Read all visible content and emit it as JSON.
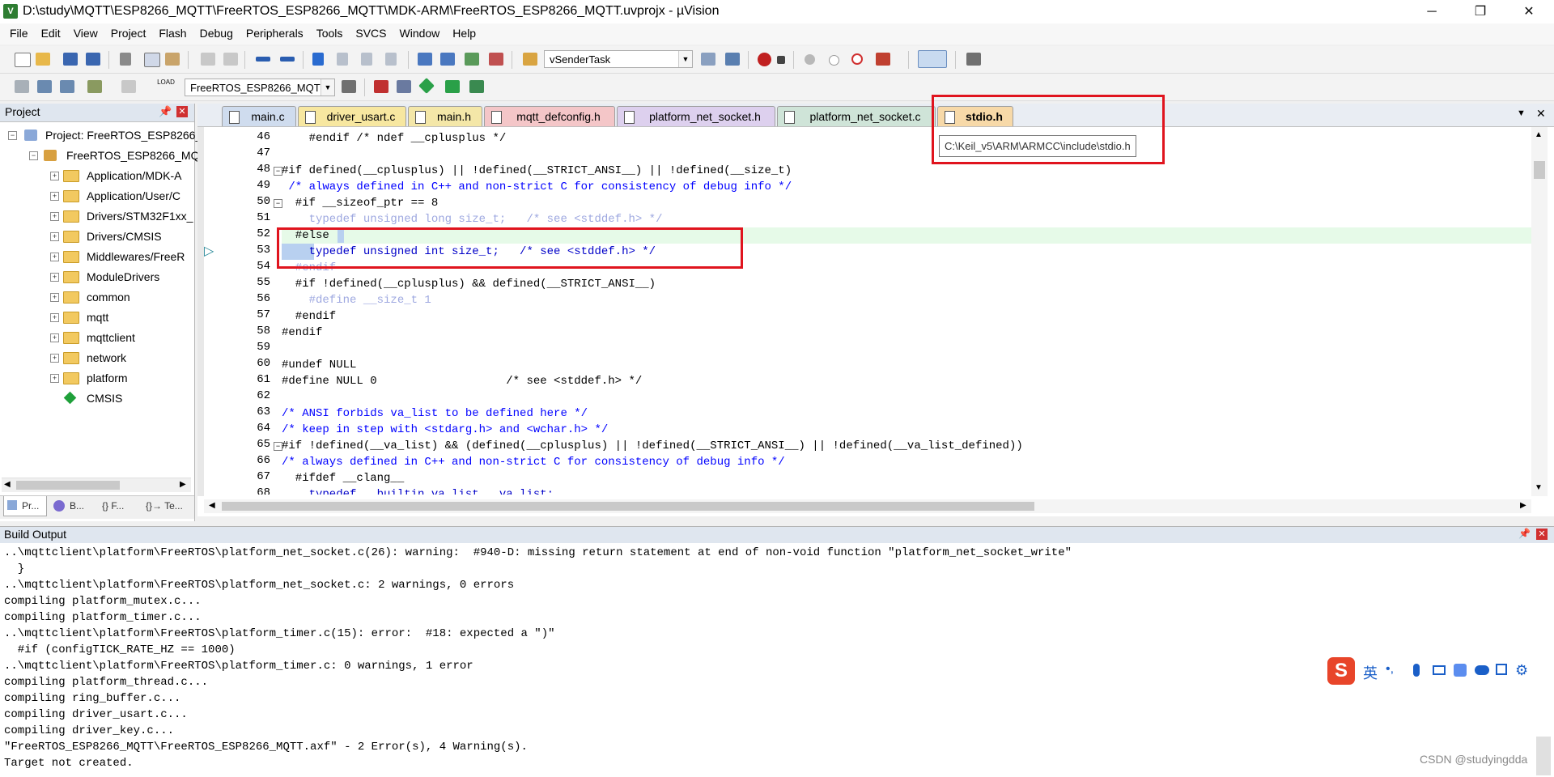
{
  "window": {
    "title": "D:\\study\\MQTT\\ESP8266_MQTT\\FreeRTOS_ESP8266_MQTT\\MDK-ARM\\FreeRTOS_ESP8266_MQTT.uvprojx - µVision",
    "minimize": "─",
    "maximize": "❐",
    "close": "✕"
  },
  "menu": [
    "File",
    "Edit",
    "View",
    "Project",
    "Flash",
    "Debug",
    "Peripherals",
    "Tools",
    "SVCS",
    "Window",
    "Help"
  ],
  "toolbar": {
    "task_combo": "vSenderTask",
    "target_combo": "FreeRTOS_ESP8266_MQT",
    "load_label": "LOAD"
  },
  "project_panel": {
    "title": "Project",
    "tree": [
      {
        "label": "Project: FreeRTOS_ESP8266_",
        "icon": "project-icon"
      },
      {
        "label": "FreeRTOS_ESP8266_MQT",
        "icon": "target-icon"
      },
      {
        "label": "Application/MDK-A",
        "icon": "folder-icon"
      },
      {
        "label": "Application/User/C",
        "icon": "folder-icon"
      },
      {
        "label": "Drivers/STM32F1xx_",
        "icon": "folder-icon"
      },
      {
        "label": "Drivers/CMSIS",
        "icon": "folder-icon"
      },
      {
        "label": "Middlewares/FreeR",
        "icon": "folder-icon"
      },
      {
        "label": "ModuleDrivers",
        "icon": "folder-icon"
      },
      {
        "label": "common",
        "icon": "folder-icon"
      },
      {
        "label": "mqtt",
        "icon": "folder-icon"
      },
      {
        "label": "mqttclient",
        "icon": "folder-icon"
      },
      {
        "label": "network",
        "icon": "folder-icon"
      },
      {
        "label": "platform",
        "icon": "folder-icon"
      },
      {
        "label": "CMSIS",
        "icon": "cmsis-diamond-icon"
      }
    ],
    "bottom_tabs": [
      "Pr...",
      "B...",
      "{} F...",
      "{}→ Te..."
    ]
  },
  "editor": {
    "tabs": [
      {
        "label": "main.c",
        "color": "#cfdcee"
      },
      {
        "label": "driver_usart.c",
        "color": "#f7e7a0"
      },
      {
        "label": "main.h",
        "color": "#f4e7a8"
      },
      {
        "label": "mqtt_defconfig.h",
        "color": "#f4c6c8"
      },
      {
        "label": "platform_net_socket.h",
        "color": "#ddd0ee"
      },
      {
        "label": "platform_net_socket.c",
        "color": "#cfe4d8"
      },
      {
        "label": "stdio.h",
        "color": "#f7d9a8"
      }
    ],
    "active_tab": "stdio.h",
    "tooltip": "C:\\Keil_v5\\ARM\\ARMCC\\include\\stdio.h",
    "lines": [
      {
        "n": "46",
        "text": "    #endif /* ndef __cplusplus */"
      },
      {
        "n": "47",
        "text": ""
      },
      {
        "n": "48",
        "text": "#if defined(__cplusplus) || !defined(__STRICT_ANSI__) || !defined(__size_t)"
      },
      {
        "n": "49",
        "text": " /* always defined in C++ and non-strict C for consistency of debug info */"
      },
      {
        "n": "50",
        "text": "  #if __sizeof_ptr == 8"
      },
      {
        "n": "51",
        "text": "    typedef unsigned long size_t;   /* see <stddef.h> */"
      },
      {
        "n": "52",
        "text": "  #else"
      },
      {
        "n": "53",
        "text": "    typedef unsigned int size_t;   /* see <stddef.h> */"
      },
      {
        "n": "54",
        "text": "  #endif"
      },
      {
        "n": "55",
        "text": "  #if !defined(__cplusplus) && defined(__STRICT_ANSI__)"
      },
      {
        "n": "56",
        "text": "    #define __size_t 1"
      },
      {
        "n": "57",
        "text": "  #endif"
      },
      {
        "n": "58",
        "text": "#endif"
      },
      {
        "n": "59",
        "text": ""
      },
      {
        "n": "60",
        "text": "#undef NULL"
      },
      {
        "n": "61",
        "text": "#define NULL 0                   /* see <stddef.h> */"
      },
      {
        "n": "62",
        "text": ""
      },
      {
        "n": "63",
        "text": "/* ANSI forbids va_list to be defined here */"
      },
      {
        "n": "64",
        "text": "/* keep in step with <stdarg.h> and <wchar.h> */"
      },
      {
        "n": "65",
        "text": "#if !defined(__va_list) && (defined(__cplusplus) || !defined(__STRICT_ANSI__) || !defined(__va_list_defined))"
      },
      {
        "n": "66",
        "text": "/* always defined in C++ and non-strict C for consistency of debug info */"
      },
      {
        "n": "67",
        "text": "  #ifdef __clang__"
      },
      {
        "n": "68",
        "text": "    typedef __builtin_va_list __va_list;"
      }
    ]
  },
  "build_output": {
    "title": "Build Output",
    "lines": [
      "..\\mqttclient\\platform\\FreeRTOS\\platform_net_socket.c(26): warning:  #940-D: missing return statement at end of non-void function \"platform_net_socket_write\"",
      "  }",
      "..\\mqttclient\\platform\\FreeRTOS\\platform_net_socket.c: 2 warnings, 0 errors",
      "compiling platform_mutex.c...",
      "compiling platform_timer.c...",
      "..\\mqttclient\\platform\\FreeRTOS\\platform_timer.c(15): error:  #18: expected a \")\"",
      "  #if (configTICK_RATE_HZ == 1000)",
      "..\\mqttclient\\platform\\FreeRTOS\\platform_timer.c: 0 warnings, 1 error",
      "compiling platform_thread.c...",
      "compiling ring_buffer.c...",
      "compiling driver_usart.c...",
      "compiling driver_key.c...",
      "\"FreeRTOS_ESP8266_MQTT\\FreeRTOS_ESP8266_MQTT.axf\" - 2 Error(s), 4 Warning(s).",
      "Target not created."
    ],
    "watermark": "CSDN @studyingdda"
  },
  "ime": {
    "logo": "S",
    "lang": "英",
    "punct": "•,"
  }
}
